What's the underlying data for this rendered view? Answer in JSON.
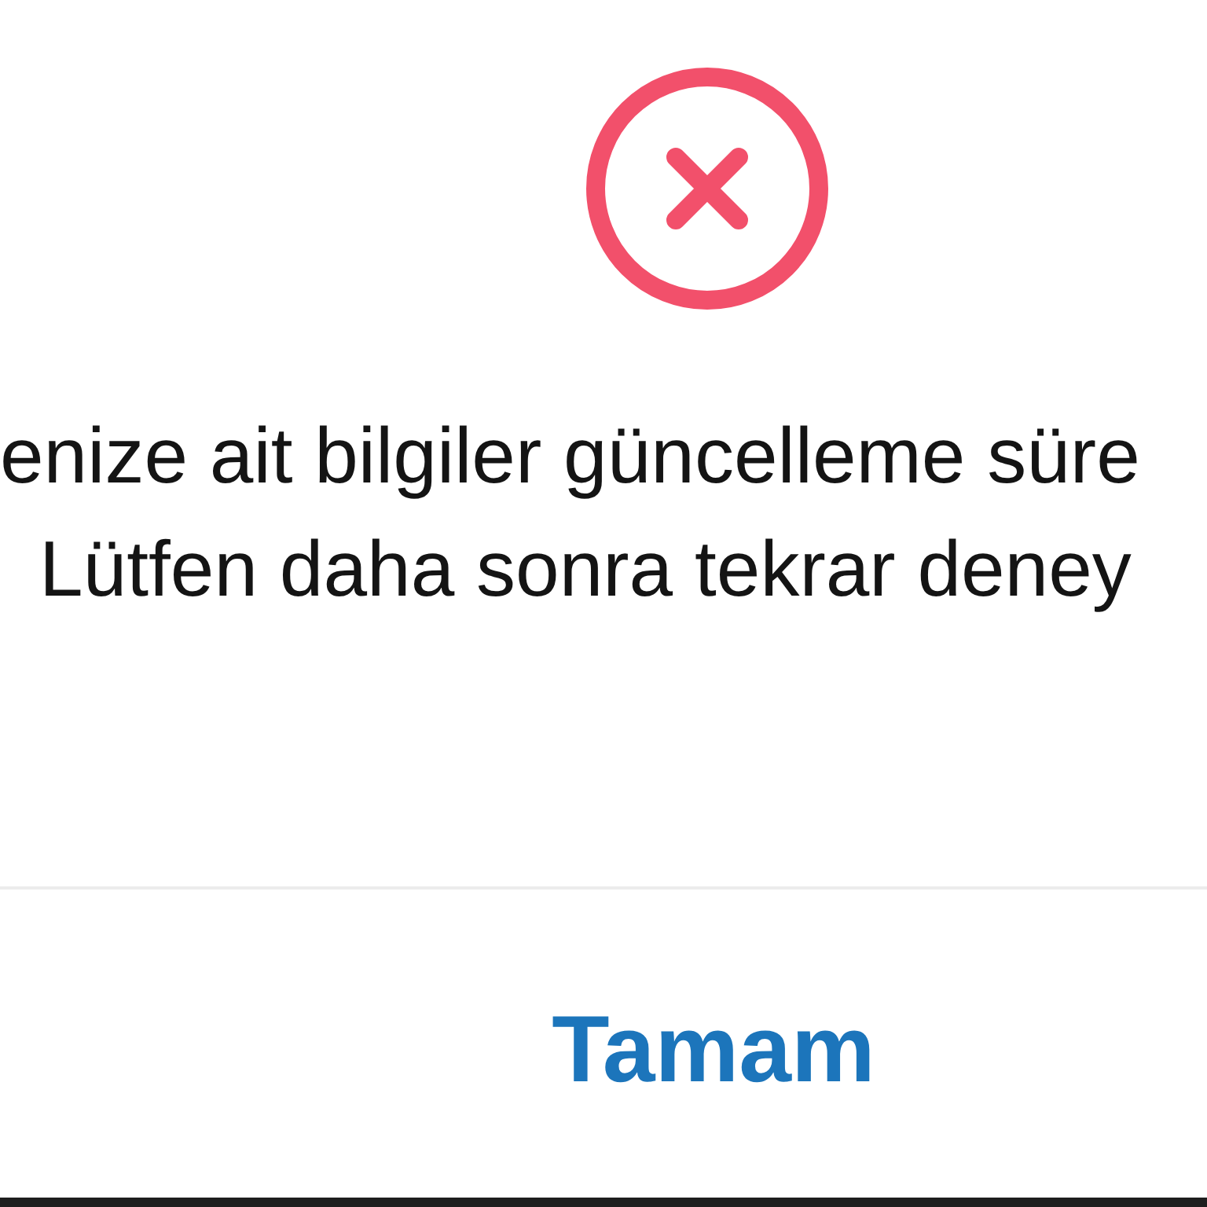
{
  "dialog": {
    "message": {
      "lines": [
        "enize ait bilgiler güncelleme süre",
        "Lütfen daha sonra tekrar deney"
      ]
    },
    "button": {
      "label": "Tamam"
    }
  }
}
